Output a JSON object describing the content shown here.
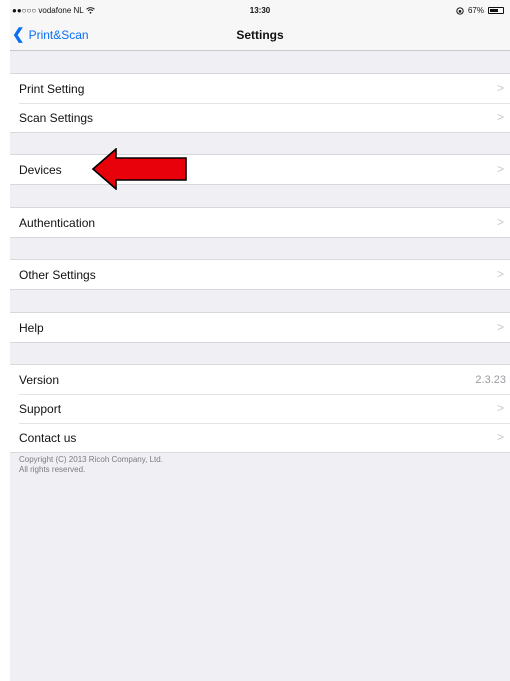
{
  "statusbar": {
    "carrier": "●●○○○ vodafone NL",
    "time": "13:30",
    "battery_percent": "67%",
    "battery_level": 0.67
  },
  "navbar": {
    "back_label": "Print&Scan",
    "title": "Settings"
  },
  "settings": {
    "print_setting": "Print Setting",
    "scan_settings": "Scan Settings",
    "devices": "Devices",
    "authentication": "Authentication",
    "other_settings": "Other Settings",
    "help": "Help",
    "version_label": "Version",
    "version_value": "2.3.23",
    "support": "Support",
    "contact_us": "Contact us"
  },
  "footer": {
    "copyright": "Copyright (C) 2013 Ricoh Company, Ltd.",
    "rights": "All rights reserved."
  },
  "colors": {
    "accent": "#0a6ff5",
    "annotation_arrow": "#e8000b"
  }
}
